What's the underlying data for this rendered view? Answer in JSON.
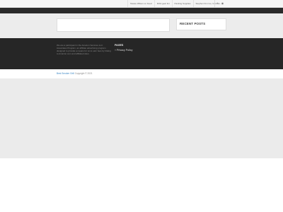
{
  "topbar": {
    "nav_items": [
      {
        "label": "Stewie Wilson on Feed"
      },
      {
        "label": "Fitbit gear list"
      },
      {
        "label": "Packing Supplies"
      },
      {
        "label": "Stephen Kim Go, Unichat..."
      }
    ],
    "social": [
      {
        "icon": "facebook-icon",
        "glyph": "f"
      },
      {
        "icon": "rss-icon",
        "glyph": "◉"
      }
    ]
  },
  "sidebar": {
    "title": "RECENT POSTS"
  },
  "footer": {
    "affiliate_text": "We are a participant in the Amazon Services LLC Associates Program, an affiliate advertising program designed to provide a means for us to earn fees by linking to Amazon.com and affiliated sites.",
    "pages_title": "PAGES",
    "pages": [
      {
        "label": "Privacy Policy"
      }
    ]
  },
  "credit": {
    "site_link": "Best Smoker Grill",
    "copyright": "Copyright © 2021"
  },
  "colors": {
    "dark_bar": "#2a2a2a",
    "footer_bg": "#262626",
    "link": "#3a86c4",
    "page_bg": "#ebebeb"
  }
}
